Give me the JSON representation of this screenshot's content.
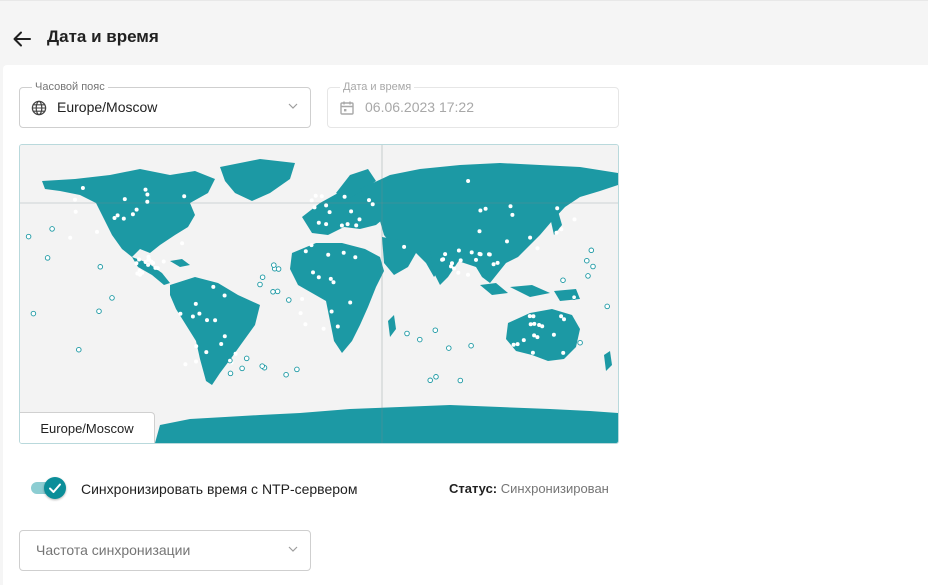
{
  "header": {
    "title": "Дата и время"
  },
  "timezone": {
    "legend": "Часовой пояс",
    "value": "Europe/Moscow"
  },
  "datetime": {
    "legend": "Дата и время",
    "value": "06.06.2023 17:22"
  },
  "map": {
    "selected_label": "Europe/Moscow",
    "land_color": "#1c99a4",
    "ocean_color": "#f3f3f3"
  },
  "sync": {
    "label": "Синхронизировать время с NTP-сервером",
    "enabled": true,
    "status_key": "Статус:",
    "status_value": "Синхронизирован"
  },
  "frequency": {
    "placeholder": "Частота синхронизации"
  },
  "colors": {
    "accent": "#0b8e99",
    "accent_light": "#8ccdd2"
  }
}
